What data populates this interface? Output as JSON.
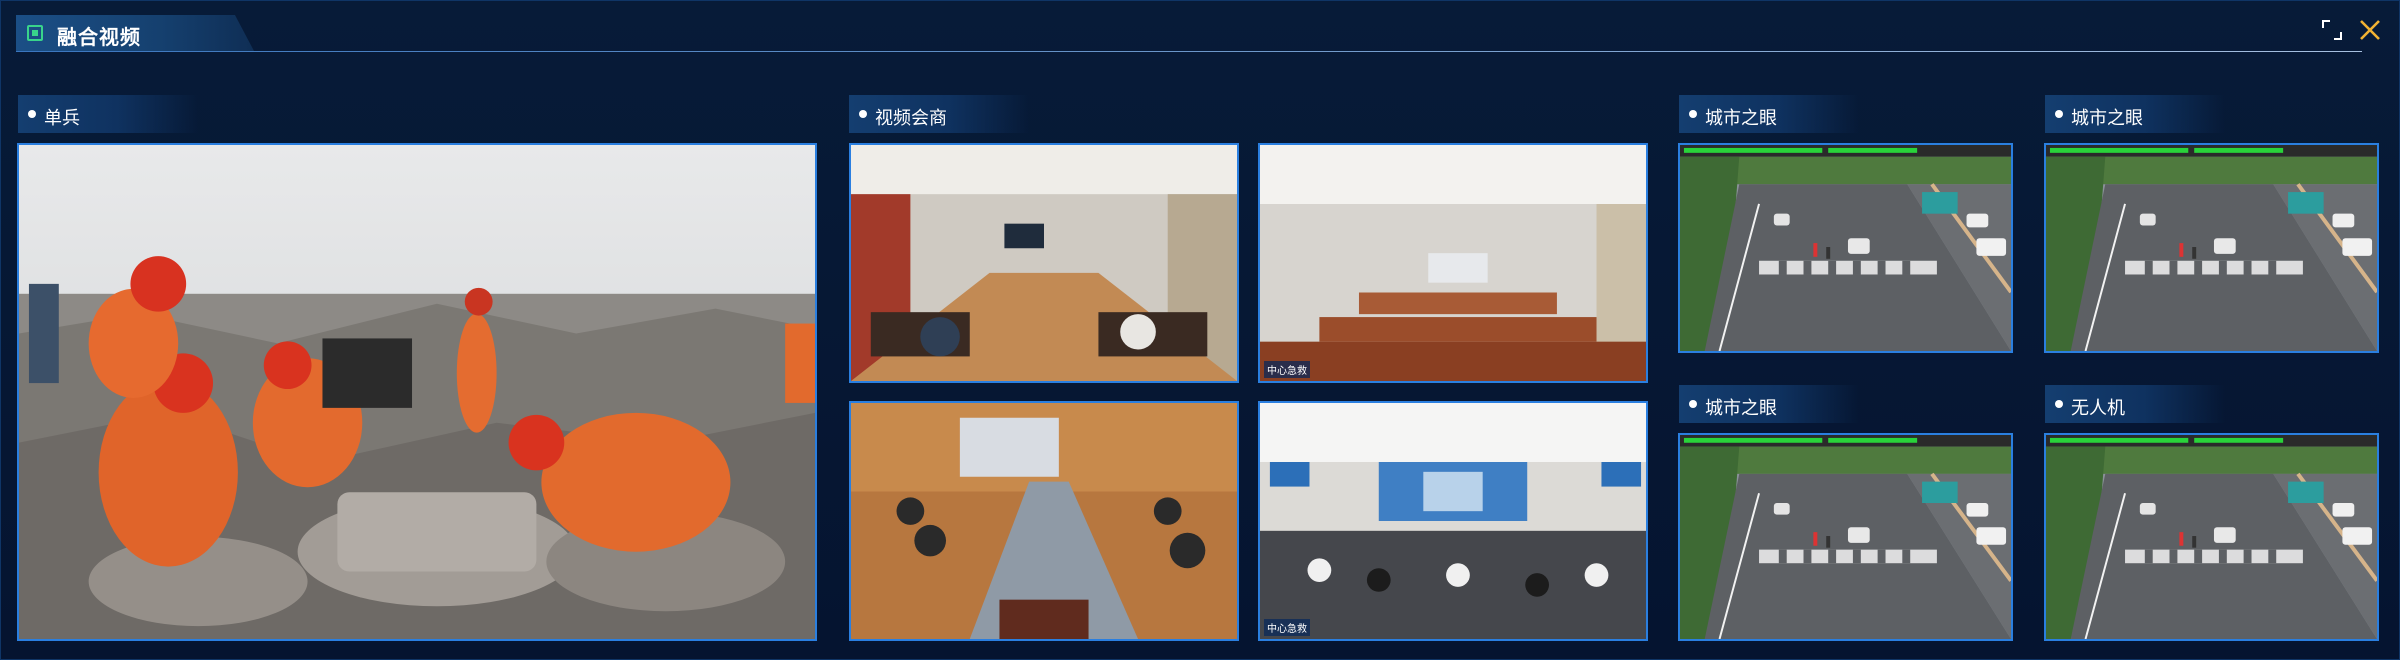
{
  "window": {
    "title": "融合视频",
    "controls": {
      "maximize_icon": "expand-icon",
      "close_icon": "close-icon"
    },
    "accent_color": "#39d48b",
    "close_color": "#f2b233"
  },
  "sections": {
    "soldier": {
      "label": "单兵"
    },
    "meeting": {
      "label": "视频会商"
    },
    "city1": {
      "label": "城市之眼"
    },
    "city2": {
      "label": "城市之眼"
    },
    "city3": {
      "label": "城市之眼"
    },
    "drone": {
      "label": "无人机"
    }
  },
  "meeting_tiles": [
    {
      "scene": "conference-room-wide"
    },
    {
      "scene": "conference-room-long-tables",
      "tag": "中心急救"
    },
    {
      "scene": "boardroom-table"
    },
    {
      "scene": "video-conference-hall",
      "tag": "中心急救"
    }
  ],
  "colors": {
    "background": "#06162e",
    "tile_border": "#2a7fe0",
    "header_fill": "#143e70"
  }
}
